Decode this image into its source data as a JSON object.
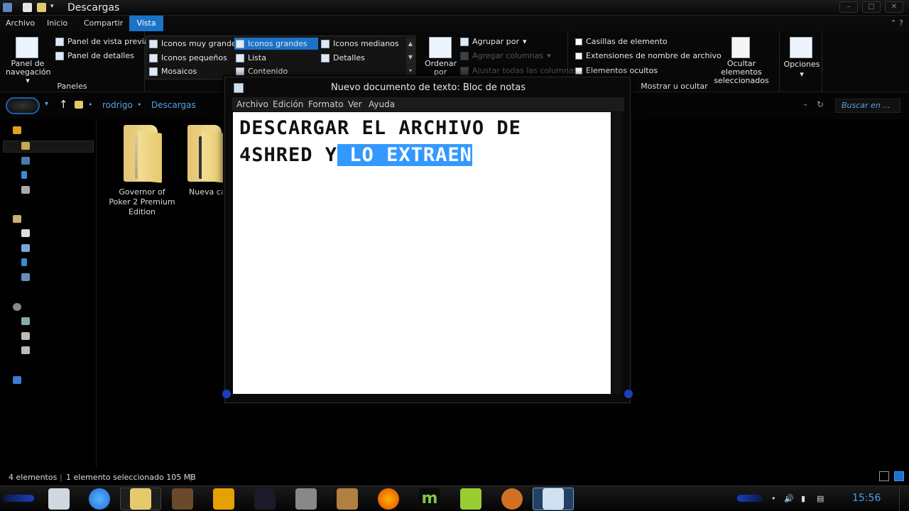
{
  "window": {
    "title": "Descargas"
  },
  "ribbon": {
    "tabs": [
      "Archivo",
      "Inicio",
      "Compartir",
      "Vista"
    ],
    "active_tab": "Vista",
    "panes": {
      "nav_pane_label": "Panel de navegación",
      "preview_label": "Panel de vista previa",
      "details_label": "Panel de detalles",
      "group_label": "Paneles"
    },
    "layout": {
      "items": [
        "Iconos muy grandes",
        "Iconos grandes",
        "Iconos medianos",
        "Iconos pequeños",
        "Lista",
        "Detalles",
        "Mosaicos",
        "Contenido"
      ],
      "selected": "Iconos grandes"
    },
    "current_view": {
      "sort_label": "Ordenar por",
      "group_by": "Agrupar por",
      "add_columns": "Agregar columnas",
      "fit_columns": "Ajustar todas las columnas"
    },
    "show_hide": {
      "item_checkboxes": "Casillas de elemento",
      "file_extensions": "Extensiones de nombre de archivo",
      "hidden_items": "Elementos ocultos",
      "hide_selected": "Ocultar elementos seleccionados",
      "group_label": "Mostrar u ocultar"
    },
    "options_label": "Opciones"
  },
  "address": {
    "crumbs": [
      "rodrigo",
      "Descargas"
    ],
    "search_placeholder": "Buscar en ..."
  },
  "files": [
    {
      "name": "Governor of Poker 2 Premium Edition"
    },
    {
      "name": "Nueva carp"
    }
  ],
  "notepad": {
    "title": "Nuevo documento de texto: Bloc de notas",
    "menu": [
      "Archivo",
      "Edición",
      "Formato",
      "Ver",
      "Ayuda"
    ],
    "line1": "DESCARGAR EL ARCHIVO DE",
    "line2_plain": "4SHRED Y",
    "line2_selected": " LO EXTRAEN"
  },
  "status": {
    "count": "4 elementos",
    "selection": "1 elemento seleccionado  105 MB"
  },
  "taskbar": {
    "clock": "15:56"
  },
  "colors": {
    "accent": "#1a73c9",
    "link": "#5aa0e6",
    "selection": "#3399ff"
  }
}
